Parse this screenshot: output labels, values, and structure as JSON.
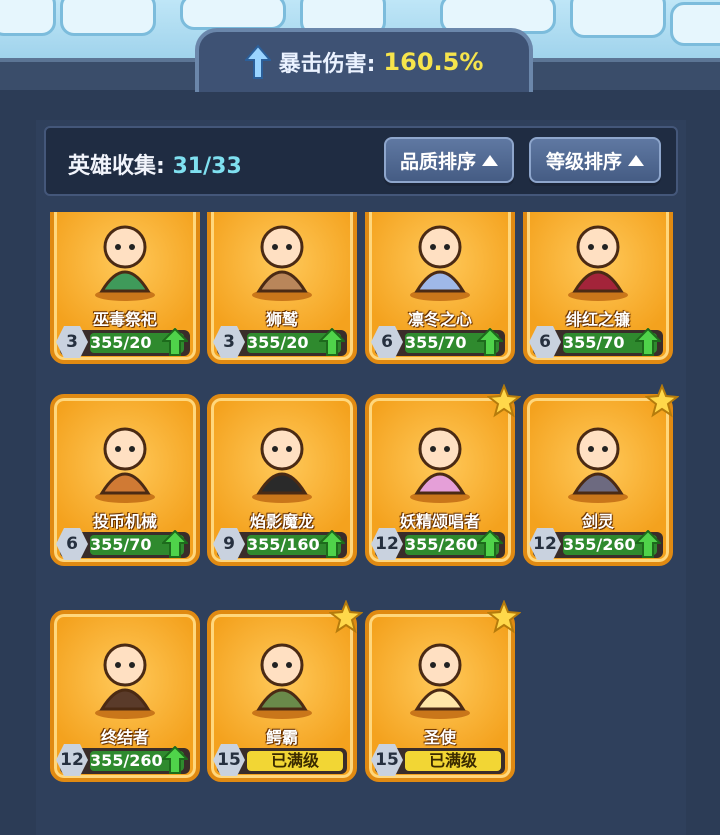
{
  "stat": {
    "label": "暴击伤害:",
    "value": "160.5%"
  },
  "collection": {
    "label": "英雄收集:",
    "count": "31/33"
  },
  "sort_buttons": {
    "quality": "品质排序",
    "level": "等级排序"
  },
  "heroes": [
    {
      "name": "巫毒祭祀",
      "level": "3",
      "progress": "355/20",
      "starred": false,
      "maxed": false
    },
    {
      "name": "狮鹫",
      "level": "3",
      "progress": "355/20",
      "starred": false,
      "maxed": false
    },
    {
      "name": "凛冬之心",
      "level": "6",
      "progress": "355/70",
      "starred": false,
      "maxed": false
    },
    {
      "name": "绯红之镰",
      "level": "6",
      "progress": "355/70",
      "starred": false,
      "maxed": false
    },
    {
      "name": "投币机械",
      "level": "6",
      "progress": "355/70",
      "starred": false,
      "maxed": false
    },
    {
      "name": "焰影魔龙",
      "level": "9",
      "progress": "355/160",
      "starred": false,
      "maxed": false
    },
    {
      "name": "妖精颂唱者",
      "level": "12",
      "progress": "355/260",
      "starred": true,
      "maxed": false
    },
    {
      "name": "剑灵",
      "level": "12",
      "progress": "355/260",
      "starred": true,
      "maxed": false
    },
    {
      "name": "终结者",
      "level": "12",
      "progress": "355/260",
      "starred": false,
      "maxed": false
    },
    {
      "name": "鳄霸",
      "level": "15",
      "progress": "已满级",
      "starred": true,
      "maxed": true
    },
    {
      "name": "圣使",
      "level": "15",
      "progress": "已满级",
      "starred": true,
      "maxed": true
    }
  ],
  "colors": {
    "card": "#f4a21e",
    "progress": "#2f8a2e",
    "max": "#f2d634",
    "accent": "#7fe0f0"
  }
}
